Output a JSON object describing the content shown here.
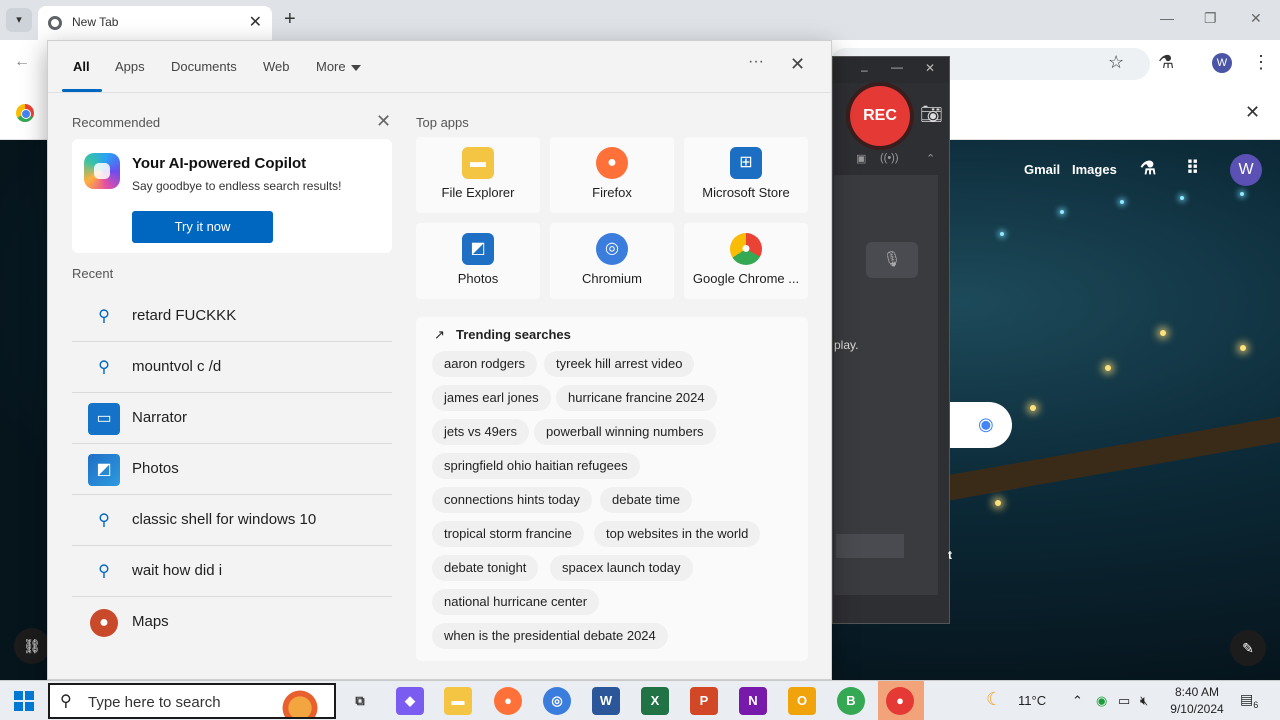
{
  "browser": {
    "tab_title": "New Tab",
    "new_tab": "+",
    "window_controls": [
      "–",
      "▢",
      "✕"
    ],
    "profile_initial": "W"
  },
  "ntp": {
    "links": [
      "Gmail",
      "Images"
    ],
    "avatar_initial": "W"
  },
  "recorder": {
    "rec_label": "REC",
    "partial_text": "play.",
    "partial_text2": "t"
  },
  "start_menu": {
    "tabs": [
      "All",
      "Apps",
      "Documents",
      "Web",
      "More"
    ],
    "active_tab": "All",
    "recommended": {
      "title": "Recommended",
      "card_title": "Your AI-powered Copilot",
      "card_subtitle": "Say goodbye to endless search results!",
      "button": "Try it now"
    },
    "recent": {
      "title": "Recent",
      "items": [
        {
          "label": "retard FUCKKK",
          "icon": "search-icon"
        },
        {
          "label": "mountvol c /d",
          "icon": "search-icon"
        },
        {
          "label": "Narrator",
          "icon": "narrator-icon"
        },
        {
          "label": "Photos",
          "icon": "photos-icon"
        },
        {
          "label": "classic shell for windows 10",
          "icon": "search-icon"
        },
        {
          "label": "wait how did i",
          "icon": "search-icon"
        },
        {
          "label": "Maps",
          "icon": "maps-icon"
        }
      ]
    },
    "top_apps": {
      "title": "Top apps",
      "apps": [
        {
          "label": "File Explorer",
          "icon": "folder-icon",
          "color": "#f4c542"
        },
        {
          "label": "Firefox",
          "icon": "firefox-icon",
          "color": "#ff7139"
        },
        {
          "label": "Microsoft Store",
          "icon": "store-icon",
          "color": "#1b6ec2"
        },
        {
          "label": "Photos",
          "icon": "photos-icon",
          "color": "#1f6fc5"
        },
        {
          "label": "Chromium",
          "icon": "chromium-icon",
          "color": "#3b7ddd"
        },
        {
          "label": "Google Chrome ...",
          "icon": "chrome-beta-icon",
          "color": "#34a853"
        }
      ]
    },
    "trending": {
      "title": "Trending searches",
      "chips": [
        [
          "aaron rodgers",
          "tyreek hill arrest video"
        ],
        [
          "james earl jones",
          "hurricane francine 2024"
        ],
        [
          "jets vs 49ers",
          "powerball winning numbers"
        ],
        [
          "springfield ohio haitian refugees"
        ],
        [
          "connections hints today",
          "debate time"
        ],
        [
          "tropical storm francine",
          "top websites in the world"
        ],
        [
          "debate tonight",
          "spacex launch today"
        ],
        [
          "national hurricane center"
        ],
        [
          "when is the presidential debate 2024"
        ]
      ]
    }
  },
  "taskbar": {
    "search_placeholder": "Type here to search",
    "apps": [
      {
        "name": "task-view-icon",
        "glyph": "⧉",
        "color": "#333333"
      },
      {
        "name": "copilot-icon",
        "glyph": "◆",
        "color": "#7b5cf0"
      },
      {
        "name": "file-explorer-icon",
        "glyph": "▬",
        "color": "#f4c542"
      },
      {
        "name": "firefox-icon",
        "glyph": "●",
        "color": "#ff7139"
      },
      {
        "name": "chromium-icon",
        "glyph": "◎",
        "color": "#3b7ddd"
      },
      {
        "name": "word-icon",
        "glyph": "W",
        "color": "#2b579a"
      },
      {
        "name": "excel-icon",
        "glyph": "X",
        "color": "#217346"
      },
      {
        "name": "powerpoint-icon",
        "glyph": "P",
        "color": "#d24726"
      },
      {
        "name": "onenote-icon",
        "glyph": "N",
        "color": "#7719aa"
      },
      {
        "name": "outlook-icon",
        "glyph": "O",
        "color": "#f0a30a"
      },
      {
        "name": "chrome-beta-icon",
        "glyph": "B",
        "color": "#34a853"
      },
      {
        "name": "recorder-icon",
        "glyph": "●",
        "color": "#e53935"
      }
    ],
    "weather": "11°C",
    "time": "8:40 AM",
    "date": "9/10/2024",
    "notifications": "6"
  }
}
